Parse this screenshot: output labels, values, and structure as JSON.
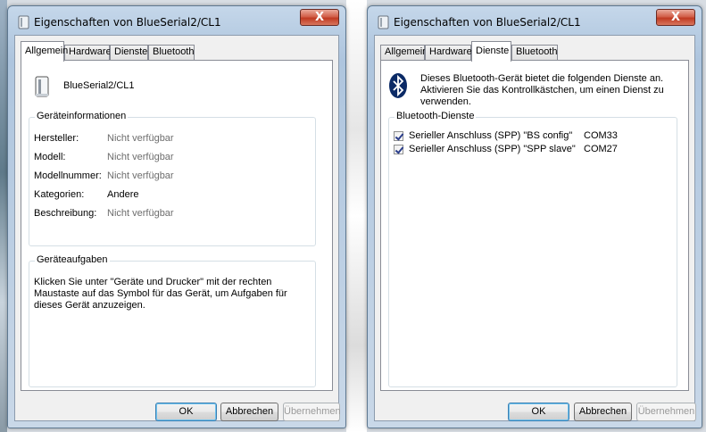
{
  "left_window": {
    "title": "Eigenschaften von BlueSerial2/CL1",
    "close_label": "X",
    "tabs": [
      {
        "label": "Allgemein",
        "active": true
      },
      {
        "label": "Hardware",
        "active": false
      },
      {
        "label": "Dienste",
        "active": false
      },
      {
        "label": "Bluetooth",
        "active": false
      }
    ],
    "device_name": "BlueSerial2/CL1",
    "device_info": {
      "legend": "Geräteinformationen",
      "rows": [
        {
          "label": "Hersteller:",
          "value": "Nicht verfügbar"
        },
        {
          "label": "Modell:",
          "value": "Nicht verfügbar"
        },
        {
          "label": "Modellnummer:",
          "value": "Nicht verfügbar"
        },
        {
          "label": "Kategorien:",
          "value": "Andere"
        },
        {
          "label": "Beschreibung:",
          "value": "Nicht verfügbar"
        }
      ]
    },
    "tasks": {
      "legend": "Geräteaufgaben",
      "text": "Klicken Sie unter \"Geräte und Drucker\" mit der rechten Maustaste auf das Symbol für das Gerät, um Aufgaben für dieses Gerät anzuzeigen."
    },
    "buttons": {
      "ok": "OK",
      "cancel": "Abbrechen",
      "apply": "Übernehmen"
    }
  },
  "right_window": {
    "title": "Eigenschaften von BlueSerial2/CL1",
    "close_label": "X",
    "tabs": [
      {
        "label": "Allgemein",
        "active": false
      },
      {
        "label": "Hardware",
        "active": false
      },
      {
        "label": "Dienste",
        "active": true
      },
      {
        "label": "Bluetooth",
        "active": false
      }
    ],
    "intro_text": "Dieses Bluetooth-Gerät bietet die folgenden Dienste an. Aktivieren Sie das Kontrollkästchen, um einen Dienst zu verwenden.",
    "services": {
      "legend": "Bluetooth-Dienste",
      "items": [
        {
          "label": "Serieller Anschluss (SPP) \"BS config\"",
          "port": "COM33",
          "checked": true
        },
        {
          "label": "Serieller Anschluss (SPP) \"SPP slave\"",
          "port": "COM27",
          "checked": true
        }
      ]
    },
    "buttons": {
      "ok": "OK",
      "cancel": "Abbrechen",
      "apply": "Übernehmen"
    }
  },
  "colors": {
    "titlebar": "#b8cde3",
    "close_button": "#c8412a",
    "bluetooth_icon": "#0b2a66",
    "default_button_border": "#3c7fb1"
  }
}
